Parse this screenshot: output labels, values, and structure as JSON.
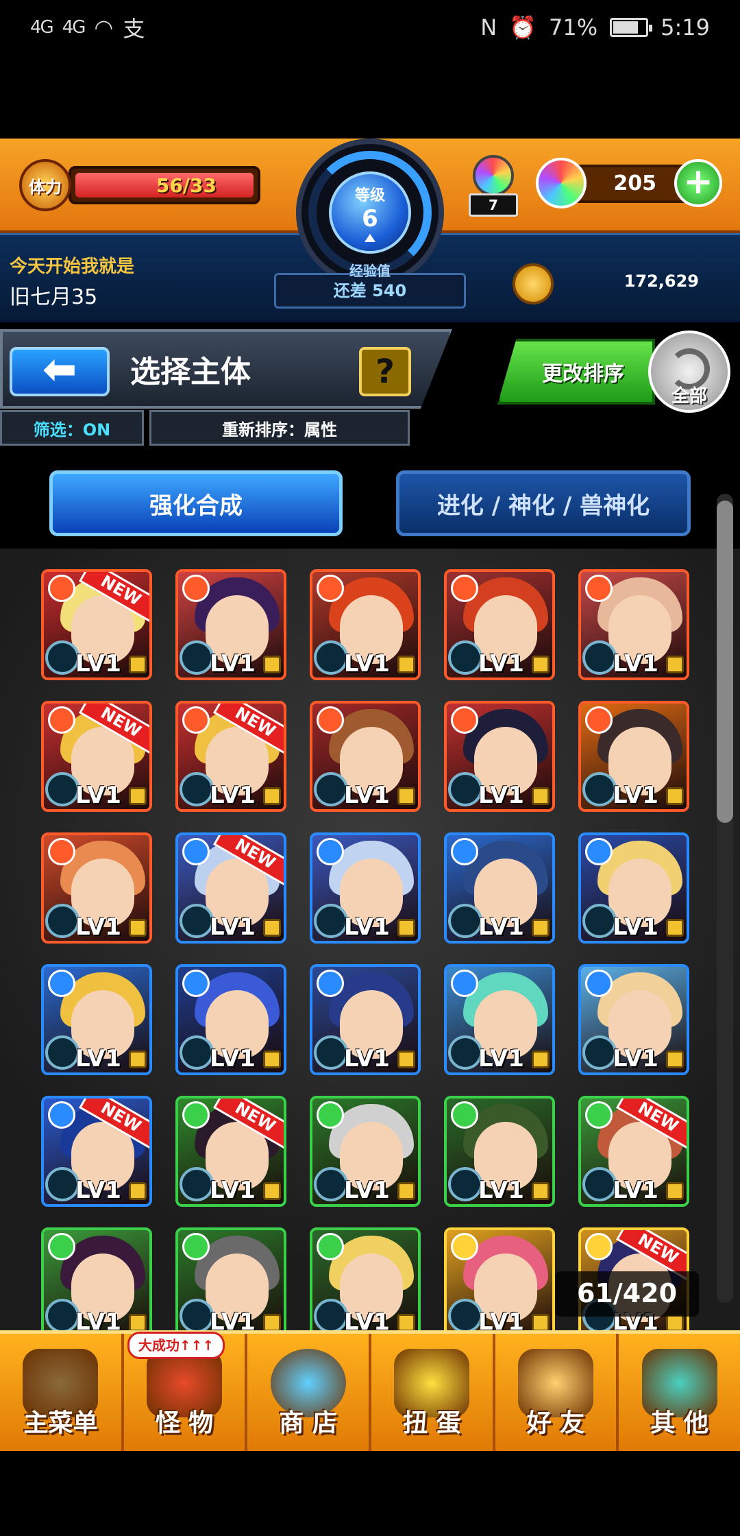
{
  "statusbar": {
    "signal1": "4G",
    "signal2": "4G",
    "app_icon": "支",
    "nfc": "N",
    "battery": "71%",
    "time": "5:19"
  },
  "hud": {
    "stamina_label": "体力",
    "stamina_value": "56/33",
    "stamina_fill_fraction": 1.0,
    "level_label": "等级",
    "level": "6",
    "exp_label": "经验值",
    "exp_remaining": "还差 540",
    "item_count": "7",
    "orb_count": "205",
    "plus_label": "+",
    "player_title": "今天开始我就是",
    "player_name": "旧七月35",
    "coins": "172,629"
  },
  "header": {
    "back_symbol": "⬅",
    "title": "选择主体",
    "help": "?",
    "filter": "筛选：ON",
    "resort": "重新排序：属性",
    "sort_button": "更改排序",
    "all_button": "全部"
  },
  "tabs": {
    "active": "强化合成",
    "inactive": "进化 / 神化 / 兽神化"
  },
  "grid": {
    "level_text": "LV1",
    "new_text": "NEW",
    "rows": [
      [
        {
          "attr": "fire",
          "new": true,
          "hair": "#f3e07a",
          "bg": "#c92d2d"
        },
        {
          "attr": "fire",
          "new": false,
          "hair": "#3a1e5a",
          "bg": "#d04242"
        },
        {
          "attr": "fire",
          "new": false,
          "hair": "#d9421a",
          "bg": "#b0392a"
        },
        {
          "attr": "fire",
          "new": false,
          "hair": "#d34020",
          "bg": "#a03030"
        },
        {
          "attr": "fire",
          "new": false,
          "hair": "#e7b89a",
          "bg": "#c64848"
        }
      ],
      [
        {
          "attr": "fire",
          "new": true,
          "hair": "#f0c040",
          "bg": "#c93030"
        },
        {
          "attr": "fire",
          "new": true,
          "hair": "#f0c040",
          "bg": "#c93030"
        },
        {
          "attr": "fire",
          "new": false,
          "hair": "#a05a30",
          "bg": "#a02828"
        },
        {
          "attr": "fire",
          "new": false,
          "hair": "#1e1e3a",
          "bg": "#c03030"
        },
        {
          "attr": "fire",
          "new": false,
          "hair": "#3a2a2a",
          "bg": "#e06a14"
        }
      ],
      [
        {
          "attr": "fire",
          "new": false,
          "hair": "#e98a50",
          "bg": "#d04a2a"
        },
        {
          "attr": "water",
          "new": true,
          "hair": "#bcd0f0",
          "bg": "#3a5ac0"
        },
        {
          "attr": "water",
          "new": false,
          "hair": "#c0d4f2",
          "bg": "#3a58c0"
        },
        {
          "attr": "water",
          "new": false,
          "hair": "#2a4a8a",
          "bg": "#2a6ad0"
        },
        {
          "attr": "water",
          "new": false,
          "hair": "#f0d070",
          "bg": "#2a4aa8"
        }
      ],
      [
        {
          "attr": "water",
          "new": false,
          "hair": "#f0c040",
          "bg": "#2a6ad0"
        },
        {
          "attr": "water",
          "new": false,
          "hair": "#3a5ad8",
          "bg": "#1e3e90"
        },
        {
          "attr": "water",
          "new": false,
          "hair": "#283a8a",
          "bg": "#2a4a9a"
        },
        {
          "attr": "water",
          "new": false,
          "hair": "#60d8c0",
          "bg": "#3a8ad0"
        },
        {
          "attr": "water",
          "new": false,
          "hair": "#f2d09a",
          "bg": "#5ab0e8"
        }
      ],
      [
        {
          "attr": "water",
          "new": true,
          "hair": "#1a3a9a",
          "bg": "#2a5ad0"
        },
        {
          "attr": "wood",
          "new": true,
          "hair": "#2a1a2a",
          "bg": "#2e8a2e"
        },
        {
          "attr": "wood",
          "new": false,
          "hair": "#d0d0d0",
          "bg": "#2a7a2a"
        },
        {
          "attr": "wood",
          "new": false,
          "hair": "#3a5a2a",
          "bg": "#2a6a2a"
        },
        {
          "attr": "wood",
          "new": true,
          "hair": "#c05a3a",
          "bg": "#3a9a3a"
        }
      ],
      [
        {
          "attr": "wood",
          "new": false,
          "hair": "#3a1a3a",
          "bg": "#3a9a3a"
        },
        {
          "attr": "wood",
          "new": false,
          "hair": "#6a6a6a",
          "bg": "#2a7a2a"
        },
        {
          "attr": "wood",
          "new": false,
          "hair": "#f0d060",
          "bg": "#2a6a2a"
        },
        {
          "attr": "light",
          "new": false,
          "hair": "#e86080",
          "bg": "#e0a020"
        },
        {
          "attr": "light",
          "new": true,
          "hair": "#2a2a6a",
          "bg": "#d09020"
        }
      ]
    ]
  },
  "counter": "61/420",
  "bottom_nav": {
    "promo": "大成功↑↑↑",
    "items": [
      "主菜单",
      "怪 物",
      "商 店",
      "扭 蛋",
      "好 友",
      "其 他"
    ]
  },
  "colors": {
    "fire": "#ff5a2a",
    "water": "#2a8aff",
    "wood": "#3ad04a",
    "light": "#ffd23a"
  }
}
